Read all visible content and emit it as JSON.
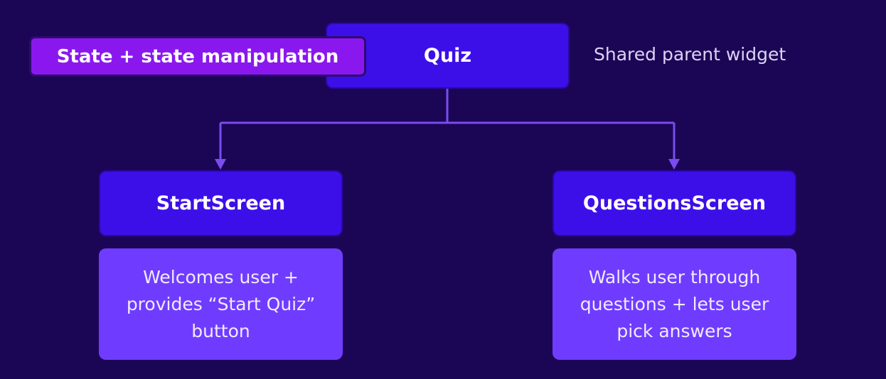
{
  "colors": {
    "background": "#1b0655",
    "node_fill": "#3d0fe8",
    "desc_fill": "#6f3cff",
    "tag_fill": "#8a18ee",
    "connector": "#7a4cf0"
  },
  "root": {
    "label": "Quiz",
    "tag": "State + state manipulation",
    "caption": "Shared parent widget"
  },
  "children": [
    {
      "label": "StartScreen",
      "description": [
        "Welcomes user +",
        "provides “Start Quiz”",
        "button"
      ]
    },
    {
      "label": "QuestionsScreen",
      "description": [
        "Walks user through",
        "questions + lets user",
        "pick answers"
      ]
    }
  ]
}
